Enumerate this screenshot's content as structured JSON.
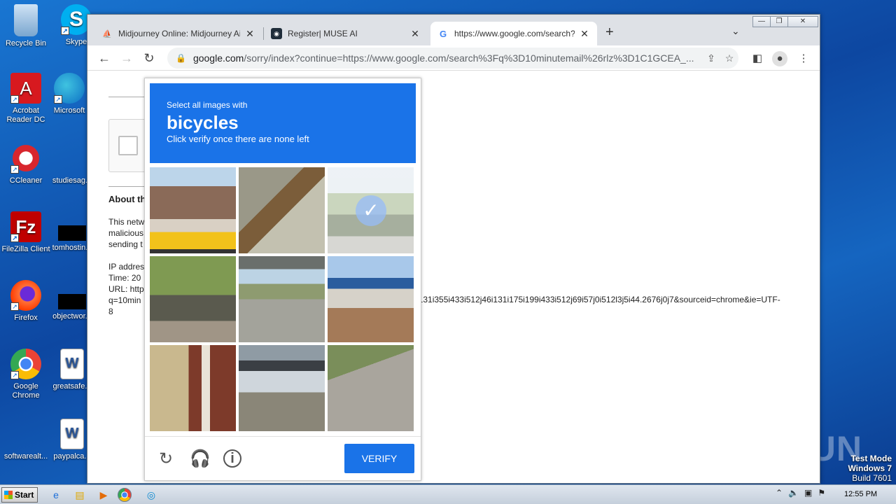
{
  "desktop": {
    "icons": [
      {
        "label": "Recycle Bin"
      },
      {
        "label": "Skype"
      },
      {
        "label": "Acrobat Reader DC"
      },
      {
        "label": "Microsoft"
      },
      {
        "label": "CCleaner"
      },
      {
        "label": "studiesag..."
      },
      {
        "label": "FileZilla Client"
      },
      {
        "label": "tomhostin..."
      },
      {
        "label": "Firefox"
      },
      {
        "label": "objectwor..."
      },
      {
        "label": "Google Chrome"
      },
      {
        "label": "greatsafe..."
      },
      {
        "label": "softwarealt..."
      },
      {
        "label": "paypalca..."
      }
    ],
    "watermark": "ANY RUN",
    "test_mode": {
      "line1": "Test Mode",
      "line2": "Windows 7",
      "line3": "Build 7601"
    }
  },
  "browser": {
    "tabs": [
      {
        "title": "Midjourney Online: Midjourney Ai On",
        "close": "✕"
      },
      {
        "title": "Register| MUSE AI",
        "close": "✕"
      },
      {
        "title": "https://www.google.com/search?q=",
        "close": "✕"
      }
    ],
    "new_tab": "+",
    "tab_list": "⌄",
    "window_controls": [
      "—",
      "❐",
      "✕"
    ],
    "url_host": "google.com",
    "url_rest": "/sorry/index?continue=https://www.google.com/search%3Fq%3D10minutemail%26rlz%3D1C1GCEA_..."
  },
  "page": {
    "about_heading": "About th",
    "para1": [
      "This netw",
      "malicious",
      "sending t"
    ],
    "para2": [
      "IP addres",
      "Time: 20",
      "URL: http",
      "q=10min",
      "8"
    ],
    "url_tail": "i131i355i433i512j46i131i175i199i433i512j69i57j0i512l3j5i44.2676j0j7&sourceid=chrome&ie=UTF-"
  },
  "captcha": {
    "select_text": "Select all images with",
    "target_word": "bicycles",
    "instruction": "Click verify once there are none left",
    "tiles": [
      {
        "name": "houses-and-school-bus",
        "selected": false
      },
      {
        "name": "awning-ceiling",
        "selected": false
      },
      {
        "name": "cyclists-on-path",
        "selected": true
      },
      {
        "name": "trees-street",
        "selected": false
      },
      {
        "name": "highway-overpass",
        "selected": false
      },
      {
        "name": "gas-station",
        "selected": false
      },
      {
        "name": "porch-railing",
        "selected": false
      },
      {
        "name": "carport-shelter",
        "selected": false
      },
      {
        "name": "road-crosswalk",
        "selected": false
      }
    ],
    "verify_label": "VERIFY",
    "check_glyph": "✓"
  },
  "taskbar": {
    "start_label": "Start",
    "clock": "12:55 PM"
  }
}
